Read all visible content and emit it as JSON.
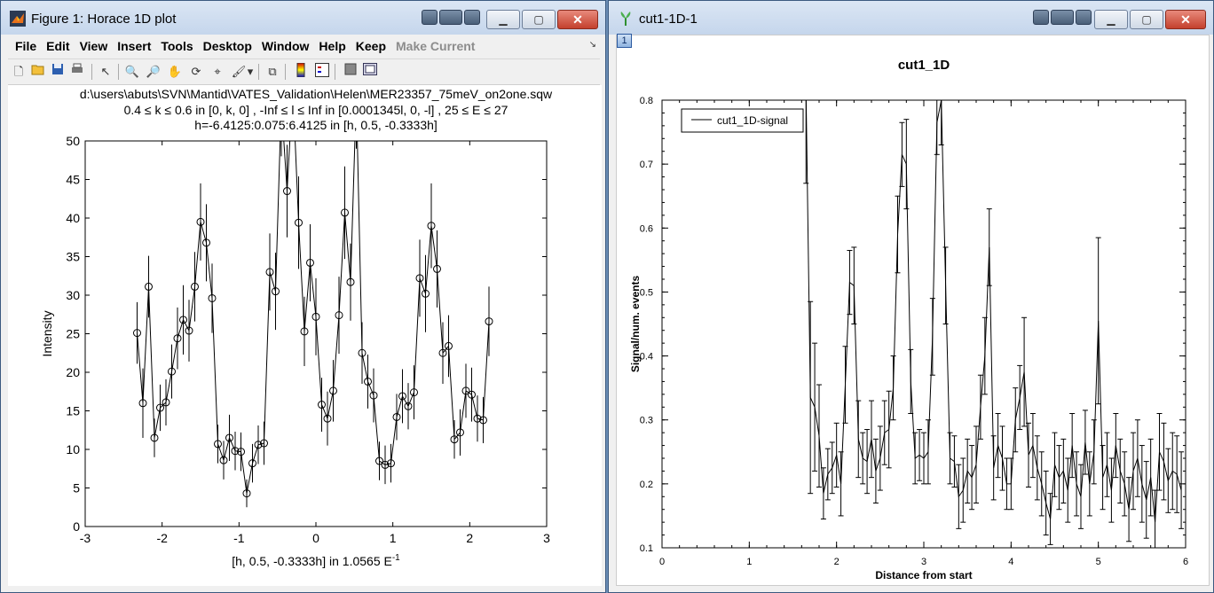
{
  "window1": {
    "title": "Figure 1: Horace 1D plot",
    "menu": [
      "File",
      "Edit",
      "View",
      "Insert",
      "Tools",
      "Desktop",
      "Window",
      "Help",
      "Keep",
      "Make Current"
    ],
    "disabled_menu": "Make Current",
    "toolbar_icons": [
      "new-icon",
      "open-icon",
      "save-icon",
      "print-icon",
      "pointer-icon",
      "zoom-in-icon",
      "zoom-out-icon",
      "pan-icon",
      "rotate-icon",
      "data-cursor-icon",
      "brush-icon",
      "brush-dropdown-icon",
      "link-plot-icon",
      "colorbar-icon",
      "legend-icon",
      "hide-plot-tools-icon",
      "show-plot-tools-icon"
    ]
  },
  "window2": {
    "title": "cut1-1D-1",
    "badge": "1"
  },
  "chart_data": [
    {
      "type": "scatter",
      "title": "d:\\users\\abuts\\SVN\\Mantid\\VATES_Validation\\Helen\\MER23357_75meV_on2one.sqw",
      "subtitle": [
        "0.4 ≤ k ≤ 0.6 in [0, k, 0] , -Inf ≤ l ≤ Inf in [0.0001345l, 0, -l] , 25 ≤ E ≤ 27",
        "h=-6.4125:0.075:6.4125 in [h, 0.5, -0.3333h]"
      ],
      "xlabel": "[h, 0.5, -0.3333h] in 1.0565 E",
      "xlabel_sup": "-1",
      "ylabel": "Intensity",
      "xlim": [
        -3,
        3
      ],
      "ylim": [
        0,
        50
      ],
      "xticks": [
        -3,
        -2,
        -1,
        0,
        1,
        2,
        3
      ],
      "yticks": [
        0,
        5,
        10,
        15,
        20,
        25,
        30,
        35,
        40,
        45,
        50
      ],
      "marker": "open-circle",
      "line": "solid",
      "errorbars": true,
      "color": "#000000",
      "x": [
        -2.325,
        -2.25,
        -2.175,
        -2.1,
        -2.025,
        -1.95,
        -1.875,
        -1.8,
        -1.725,
        -1.65,
        -1.575,
        -1.5,
        -1.425,
        -1.35,
        -1.275,
        -1.2,
        -1.125,
        -1.05,
        -0.975,
        -0.9,
        -0.825,
        -0.75,
        -0.675,
        -0.6,
        -0.525,
        -0.45,
        -0.375,
        -0.3,
        -0.225,
        -0.15,
        -0.075,
        0.0,
        0.075,
        0.15,
        0.225,
        0.3,
        0.375,
        0.45,
        0.525,
        0.6,
        0.675,
        0.75,
        0.825,
        0.9,
        0.975,
        1.05,
        1.125,
        1.2,
        1.275,
        1.35,
        1.425,
        1.5,
        1.575,
        1.65,
        1.725,
        1.8,
        1.875,
        1.95,
        2.025,
        2.1,
        2.175,
        2.25
      ],
      "y": [
        25.1,
        16.0,
        31.1,
        11.5,
        15.4,
        16.1,
        20.1,
        24.4,
        26.8,
        25.4,
        31.1,
        39.5,
        36.8,
        29.6,
        10.7,
        8.6,
        11.5,
        9.8,
        9.7,
        4.3,
        8.2,
        10.6,
        10.8,
        33.0,
        30.5,
        55.0,
        43.5,
        57.0,
        39.4,
        25.3,
        34.2,
        27.2,
        15.8,
        14.0,
        17.6,
        27.4,
        40.7,
        31.7,
        56.0,
        22.5,
        18.8,
        17.0,
        8.5,
        8.0,
        8.2,
        14.2,
        16.9,
        15.6,
        17.4,
        32.2,
        30.2,
        39.0,
        33.4,
        22.5,
        23.4,
        11.3,
        12.2,
        17.6,
        17.1,
        14.0,
        13.8,
        26.6
      ],
      "yerr": [
        4.0,
        4.5,
        4.0,
        2.5,
        3.0,
        3.0,
        3.5,
        4.0,
        4.5,
        4.0,
        4.5,
        5.0,
        5.0,
        4.5,
        2.5,
        2.5,
        3.0,
        2.5,
        2.5,
        1.8,
        2.5,
        2.5,
        2.8,
        5.0,
        5.0,
        7.0,
        6.0,
        7.0,
        6.0,
        4.5,
        5.0,
        5.0,
        3.5,
        3.5,
        4.0,
        5.0,
        6.0,
        5.0,
        7.0,
        4.0,
        3.5,
        3.5,
        2.5,
        2.5,
        2.5,
        3.0,
        3.5,
        3.0,
        3.5,
        5.0,
        5.0,
        5.5,
        5.0,
        4.0,
        4.0,
        2.5,
        3.0,
        3.5,
        3.5,
        3.0,
        3.0,
        4.5
      ]
    },
    {
      "type": "line",
      "title": "cut1_1D",
      "xlabel": "Distance from start",
      "ylabel": "Signal/num. events",
      "xlim": [
        0,
        6
      ],
      "ylim": [
        0.1,
        0.8
      ],
      "xticks": [
        0,
        1,
        2,
        3,
        4,
        5,
        6
      ],
      "yticks": [
        0.1,
        0.2,
        0.3,
        0.4,
        0.5,
        0.6,
        0.7,
        0.8
      ],
      "legend": {
        "entries": [
          "cut1_1D-signal"
        ],
        "position": "top-left"
      },
      "errorbars": true,
      "color": "#000000",
      "series": [
        {
          "name": "cut1_1D-signal",
          "x": [
            1.65,
            1.7,
            1.75,
            1.8,
            1.85,
            1.9,
            1.95,
            2.0,
            2.05,
            2.1,
            2.15,
            2.2,
            2.25,
            2.3,
            2.35,
            2.4,
            2.45,
            2.5,
            2.55,
            2.6,
            2.65,
            2.7,
            2.75,
            2.8,
            2.85,
            2.9,
            2.95,
            3.0,
            3.05,
            3.1,
            3.15,
            3.2,
            3.25,
            3.3,
            3.35,
            3.4,
            3.45,
            3.5,
            3.55,
            3.6,
            3.65,
            3.7,
            3.75,
            3.8,
            3.85,
            3.9,
            3.95,
            4.0,
            4.05,
            4.1,
            4.15,
            4.2,
            4.25,
            4.3,
            4.35,
            4.4,
            4.45,
            4.5,
            4.55,
            4.6,
            4.65,
            4.7,
            4.75,
            4.8,
            4.85,
            4.9,
            4.95,
            5.0,
            5.05,
            5.1,
            5.15,
            5.2,
            5.25,
            5.3,
            5.35,
            5.4,
            5.45,
            5.5,
            5.55,
            5.6,
            5.65,
            5.7,
            5.75,
            5.8,
            5.85,
            5.9,
            5.95
          ],
          "y": [
            0.82,
            0.335,
            0.32,
            0.275,
            0.185,
            0.215,
            0.225,
            0.245,
            0.2,
            0.355,
            0.515,
            0.51,
            0.27,
            0.24,
            0.235,
            0.27,
            0.22,
            0.24,
            0.28,
            0.285,
            0.35,
            0.59,
            0.715,
            0.7,
            0.36,
            0.24,
            0.245,
            0.24,
            0.25,
            0.43,
            0.765,
            0.8,
            0.51,
            0.24,
            0.235,
            0.18,
            0.19,
            0.22,
            0.21,
            0.23,
            0.32,
            0.4,
            0.57,
            0.225,
            0.26,
            0.24,
            0.2,
            0.2,
            0.3,
            0.335,
            0.375,
            0.245,
            0.26,
            0.225,
            0.2,
            0.17,
            0.145,
            0.23,
            0.21,
            0.22,
            0.19,
            0.26,
            0.2,
            0.18,
            0.265,
            0.2,
            0.25,
            0.455,
            0.21,
            0.23,
            0.19,
            0.26,
            0.22,
            0.2,
            0.16,
            0.22,
            0.24,
            0.2,
            0.175,
            0.21,
            0.14,
            0.25,
            0.235,
            0.205,
            0.22,
            0.215,
            0.19
          ],
          "yerr": [
            0.15,
            0.15,
            0.1,
            0.08,
            0.04,
            0.04,
            0.04,
            0.05,
            0.05,
            0.06,
            0.05,
            0.06,
            0.06,
            0.04,
            0.05,
            0.06,
            0.05,
            0.05,
            0.05,
            0.06,
            0.05,
            0.06,
            0.05,
            0.07,
            0.05,
            0.04,
            0.04,
            0.04,
            0.05,
            0.06,
            0.05,
            0.07,
            0.06,
            0.04,
            0.04,
            0.05,
            0.05,
            0.05,
            0.05,
            0.06,
            0.05,
            0.06,
            0.06,
            0.05,
            0.05,
            0.05,
            0.04,
            0.04,
            0.05,
            0.05,
            0.085,
            0.05,
            0.05,
            0.05,
            0.05,
            0.05,
            0.04,
            0.05,
            0.05,
            0.05,
            0.05,
            0.05,
            0.05,
            0.05,
            0.05,
            0.05,
            0.05,
            0.13,
            0.05,
            0.05,
            0.05,
            0.05,
            0.05,
            0.05,
            0.05,
            0.06,
            0.06,
            0.06,
            0.06,
            0.06,
            0.05,
            0.06,
            0.06,
            0.05,
            0.06,
            0.06,
            0.06
          ]
        }
      ]
    }
  ]
}
